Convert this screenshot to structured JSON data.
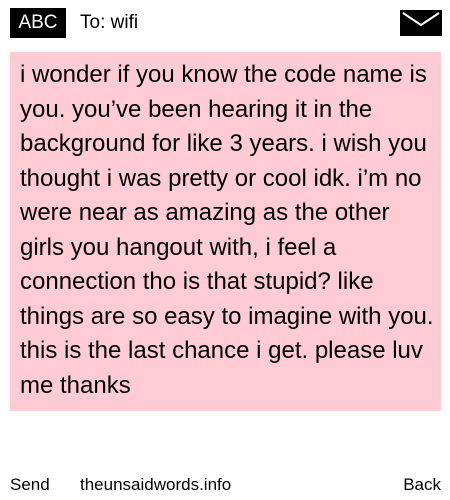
{
  "header": {
    "badge": "ABC",
    "to": "To: wifi",
    "icon": "envelope-icon"
  },
  "message": {
    "text": "i wonder if you know the code name is you. you’ve been hearing it in the background for like 3 years. i wish you thought i was pretty or cool idk. i’m no were near as amazing as the other girls you hangout with, i feel a connection tho is that stupid? like things are so easy to imagine with you. this is the last chance i get. please luv me thanks",
    "highlight_color": "#ffccd5"
  },
  "footer": {
    "send": "Send",
    "site": "theunsaidwords.info",
    "back": "Back"
  }
}
